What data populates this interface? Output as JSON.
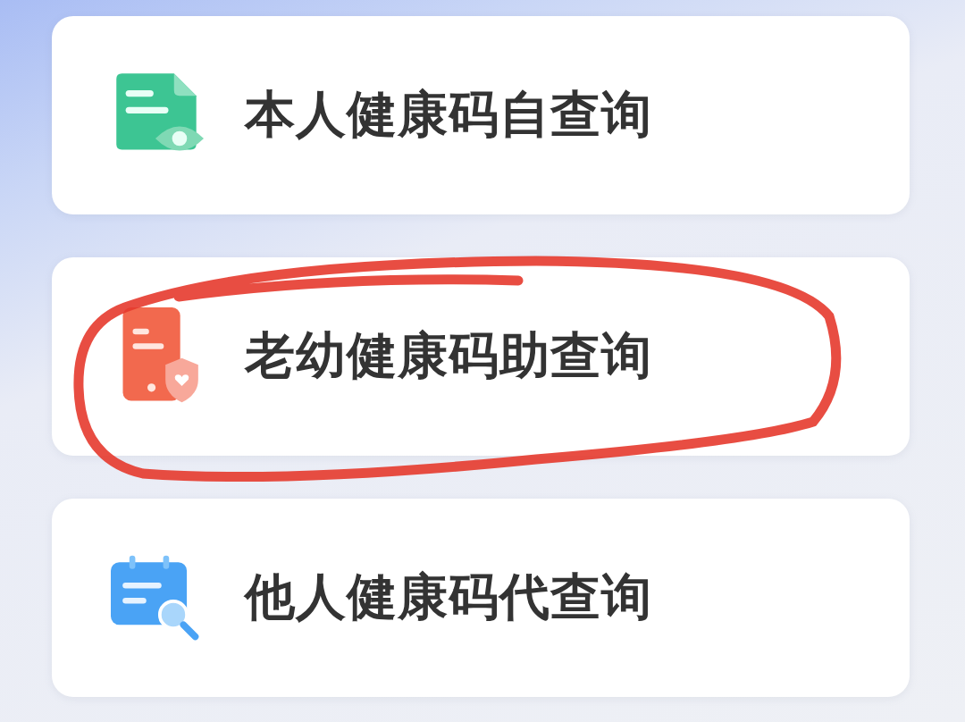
{
  "items": [
    {
      "label": "本人健康码自查询",
      "circled": false
    },
    {
      "label": "老幼健康码助查询",
      "circled": true
    },
    {
      "label": "他人健康码代查询",
      "circled": false
    }
  ]
}
